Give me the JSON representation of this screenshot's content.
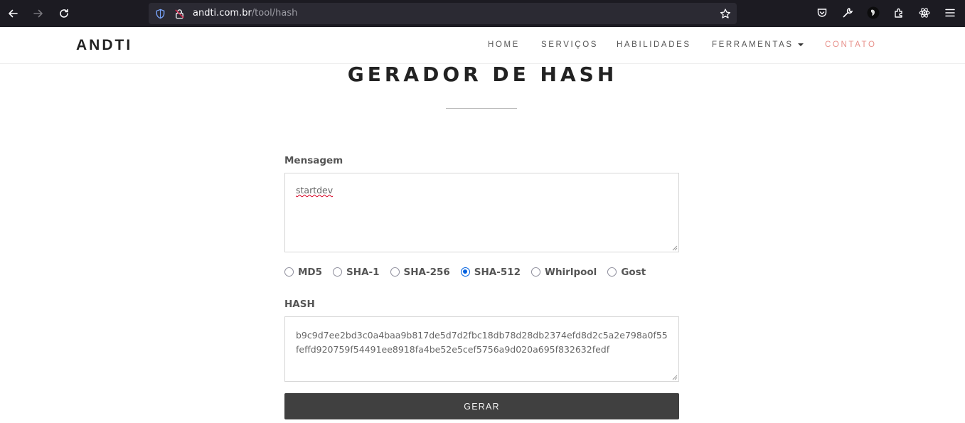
{
  "browser": {
    "url_domain": "andti.com.br",
    "url_path": "/tool/hash"
  },
  "header": {
    "brand": "ANDTI",
    "nav": {
      "home": "HOME",
      "servicos": "SERVIÇOS",
      "habilidades": "HABILIDADES",
      "ferramentas": "FERRAMENTAS",
      "contato": "CONTATO"
    },
    "active_color": "#e8918b"
  },
  "main": {
    "title": "GERADOR DE HASH",
    "message_label": "Mensagem",
    "message_value": "startdev",
    "algorithms": [
      {
        "label": "MD5",
        "checked": false
      },
      {
        "label": "SHA-1",
        "checked": false
      },
      {
        "label": "SHA-256",
        "checked": false
      },
      {
        "label": "SHA-512",
        "checked": true
      },
      {
        "label": "Whirlpool",
        "checked": false
      },
      {
        "label": "Gost",
        "checked": false
      }
    ],
    "hash_label": "HASH",
    "hash_value": "b9c9d7ee2bd3c0a4baa9b817de5d7d2fbc18db78d28db2374efd8d2c5a2e798a0f55feffd920759f54491ee8918fa4be52e5cef5756a9d020a695f832632fedf",
    "submit_label": "GERAR"
  },
  "colors": {
    "browser_bg": "#1c1b22",
    "button_bg": "#404040",
    "radio_checked": "#0060df"
  },
  "icons": [
    "back-icon",
    "forward-icon",
    "reload-icon",
    "shield-icon",
    "lock-icon",
    "bookmark-star-icon",
    "pocket-icon",
    "wrench-icon",
    "extension-avatar-icon",
    "extensions-icon",
    "react-icon",
    "menu-icon"
  ]
}
